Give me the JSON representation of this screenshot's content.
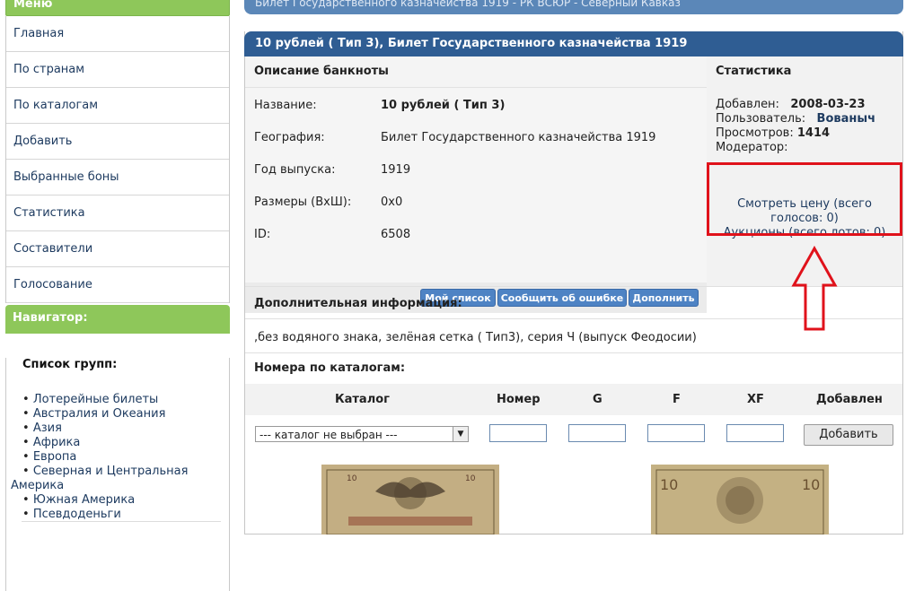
{
  "sidebar": {
    "menu_title": "Меню",
    "items": [
      {
        "label": "Главная"
      },
      {
        "label": "По странам"
      },
      {
        "label": "По каталогам"
      },
      {
        "label": "Добавить"
      },
      {
        "label": "Выбранные боны"
      },
      {
        "label": "Статистика"
      },
      {
        "label": "Составители"
      },
      {
        "label": "Голосование"
      }
    ],
    "navigator_title": "Навигатор:",
    "group_list_title": "Список групп:",
    "groups": [
      "Лотерейные билеты",
      "Австралия и Океания",
      "Азия",
      "Африка",
      "Европа",
      "Северная и Центральная",
      "Америка",
      "Южная Америка",
      "Псевдоденьги"
    ]
  },
  "topbar_text": "Билет Государственного казначейства 1919 - РК ВСЮР - Северный Кавказ",
  "panel": {
    "title": "10 рублей ( Тип 3), Билет Государственного казначейства 1919",
    "desc_title": "Описание банкноты",
    "fields": [
      {
        "key": "Название:",
        "value": "10 рублей ( Тип 3)"
      },
      {
        "key": "География:",
        "value": "Билет Государственного казначейства 1919"
      },
      {
        "key": "Год выпуска:",
        "value": "1919"
      },
      {
        "key": "Размеры (ВхШ):",
        "value": "0x0"
      },
      {
        "key": "ID:",
        "value": "6508"
      }
    ],
    "buttons": {
      "my_list": "Мой список",
      "report": "Сообщить об ошибке",
      "add_more": "Дополнить"
    },
    "stats_title": "Статистика",
    "stats": {
      "added_label": "Добавлен:",
      "added_value": "2008-03-23",
      "user_label": "Пользователь:",
      "user_value": "Вованыч",
      "views_label": "Просмотров:",
      "views_value": "1414",
      "moderator_label": "Модератор:"
    },
    "price_link_1": "Смотреть цену (всего",
    "price_link_2": "голосов: 0)",
    "auctions_link": "Аукционы (всего лотов: 0)",
    "extra_title": "Дополнительная информация:",
    "extra_text": ",без водяного знака, зелёная сетка ( Тип3), серия Ч (выпуск Феодосии)",
    "catalogs_title": "Номера по каталогам:",
    "catalog_columns": [
      "Каталог",
      "Номер",
      "G",
      "F",
      "XF",
      "Добавлен"
    ],
    "catalog_select": "--- каталог не выбран ---",
    "add_button": "Добавить"
  },
  "colors": {
    "header_blue": "#2f5d93",
    "menu_green": "#8ec75a",
    "highlight_red": "#e0121b",
    "button_blue": "#4e83c4"
  }
}
